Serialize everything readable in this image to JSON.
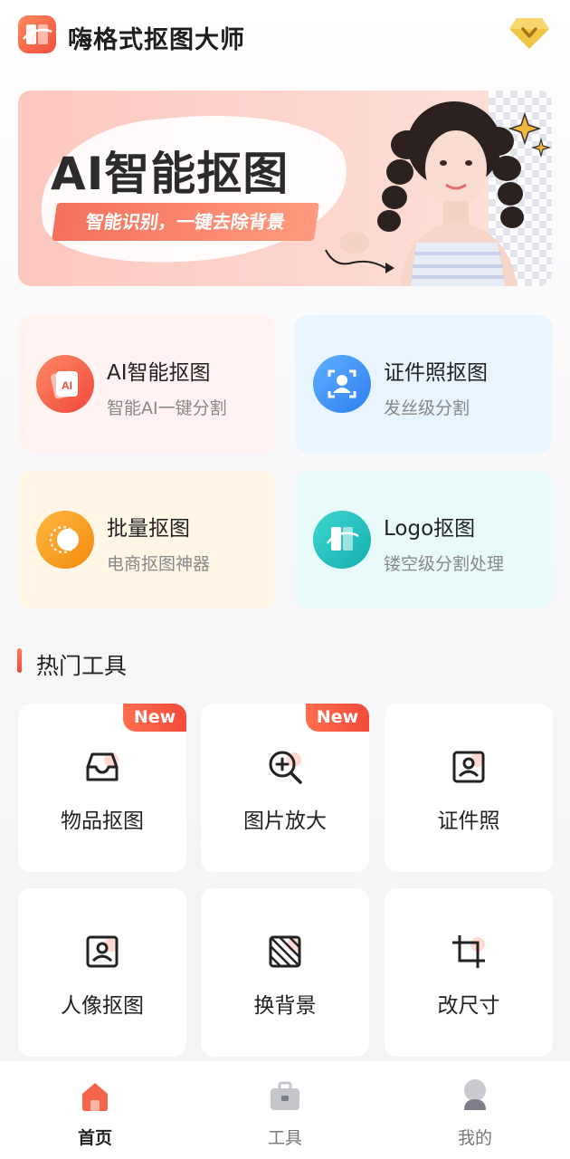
{
  "app": {
    "title": "嗨格式抠图大师"
  },
  "banner": {
    "title": "AI智能抠图",
    "subtitle": "智能识别，一键去除背景"
  },
  "features": [
    {
      "title": "AI智能抠图",
      "subtitle": "智能AI一键分割",
      "icon": "ai-cutout-icon",
      "color": "#f4654c"
    },
    {
      "title": "证件照抠图",
      "subtitle": "发丝级分割",
      "icon": "id-photo-icon",
      "color": "#3e8ef7"
    },
    {
      "title": "批量抠图",
      "subtitle": "电商抠图神器",
      "icon": "batch-icon",
      "color": "#f59b1a"
    },
    {
      "title": "Logo抠图",
      "subtitle": "镂空级分割处理",
      "icon": "logo-icon",
      "color": "#22c2c0"
    }
  ],
  "section": {
    "title": "热门工具"
  },
  "tools": [
    {
      "label": "物品抠图",
      "badge": "New",
      "icon": "tray-icon"
    },
    {
      "label": "图片放大",
      "badge": "New",
      "icon": "zoom-in-icon"
    },
    {
      "label": "证件照",
      "badge": "",
      "icon": "portrait-frame-icon"
    },
    {
      "label": "人像抠图",
      "badge": "",
      "icon": "portrait-frame-icon"
    },
    {
      "label": "换背景",
      "badge": "",
      "icon": "hatched-square-icon"
    },
    {
      "label": "改尺寸",
      "badge": "",
      "icon": "crop-icon"
    }
  ],
  "tabbar": [
    {
      "label": "首页",
      "active": true,
      "icon": "home-icon"
    },
    {
      "label": "工具",
      "active": false,
      "icon": "toolbox-icon"
    },
    {
      "label": "我的",
      "active": false,
      "icon": "profile-icon"
    }
  ],
  "colors": {
    "accent": "#f24b3a",
    "text": "#222222",
    "muted": "#888888"
  }
}
